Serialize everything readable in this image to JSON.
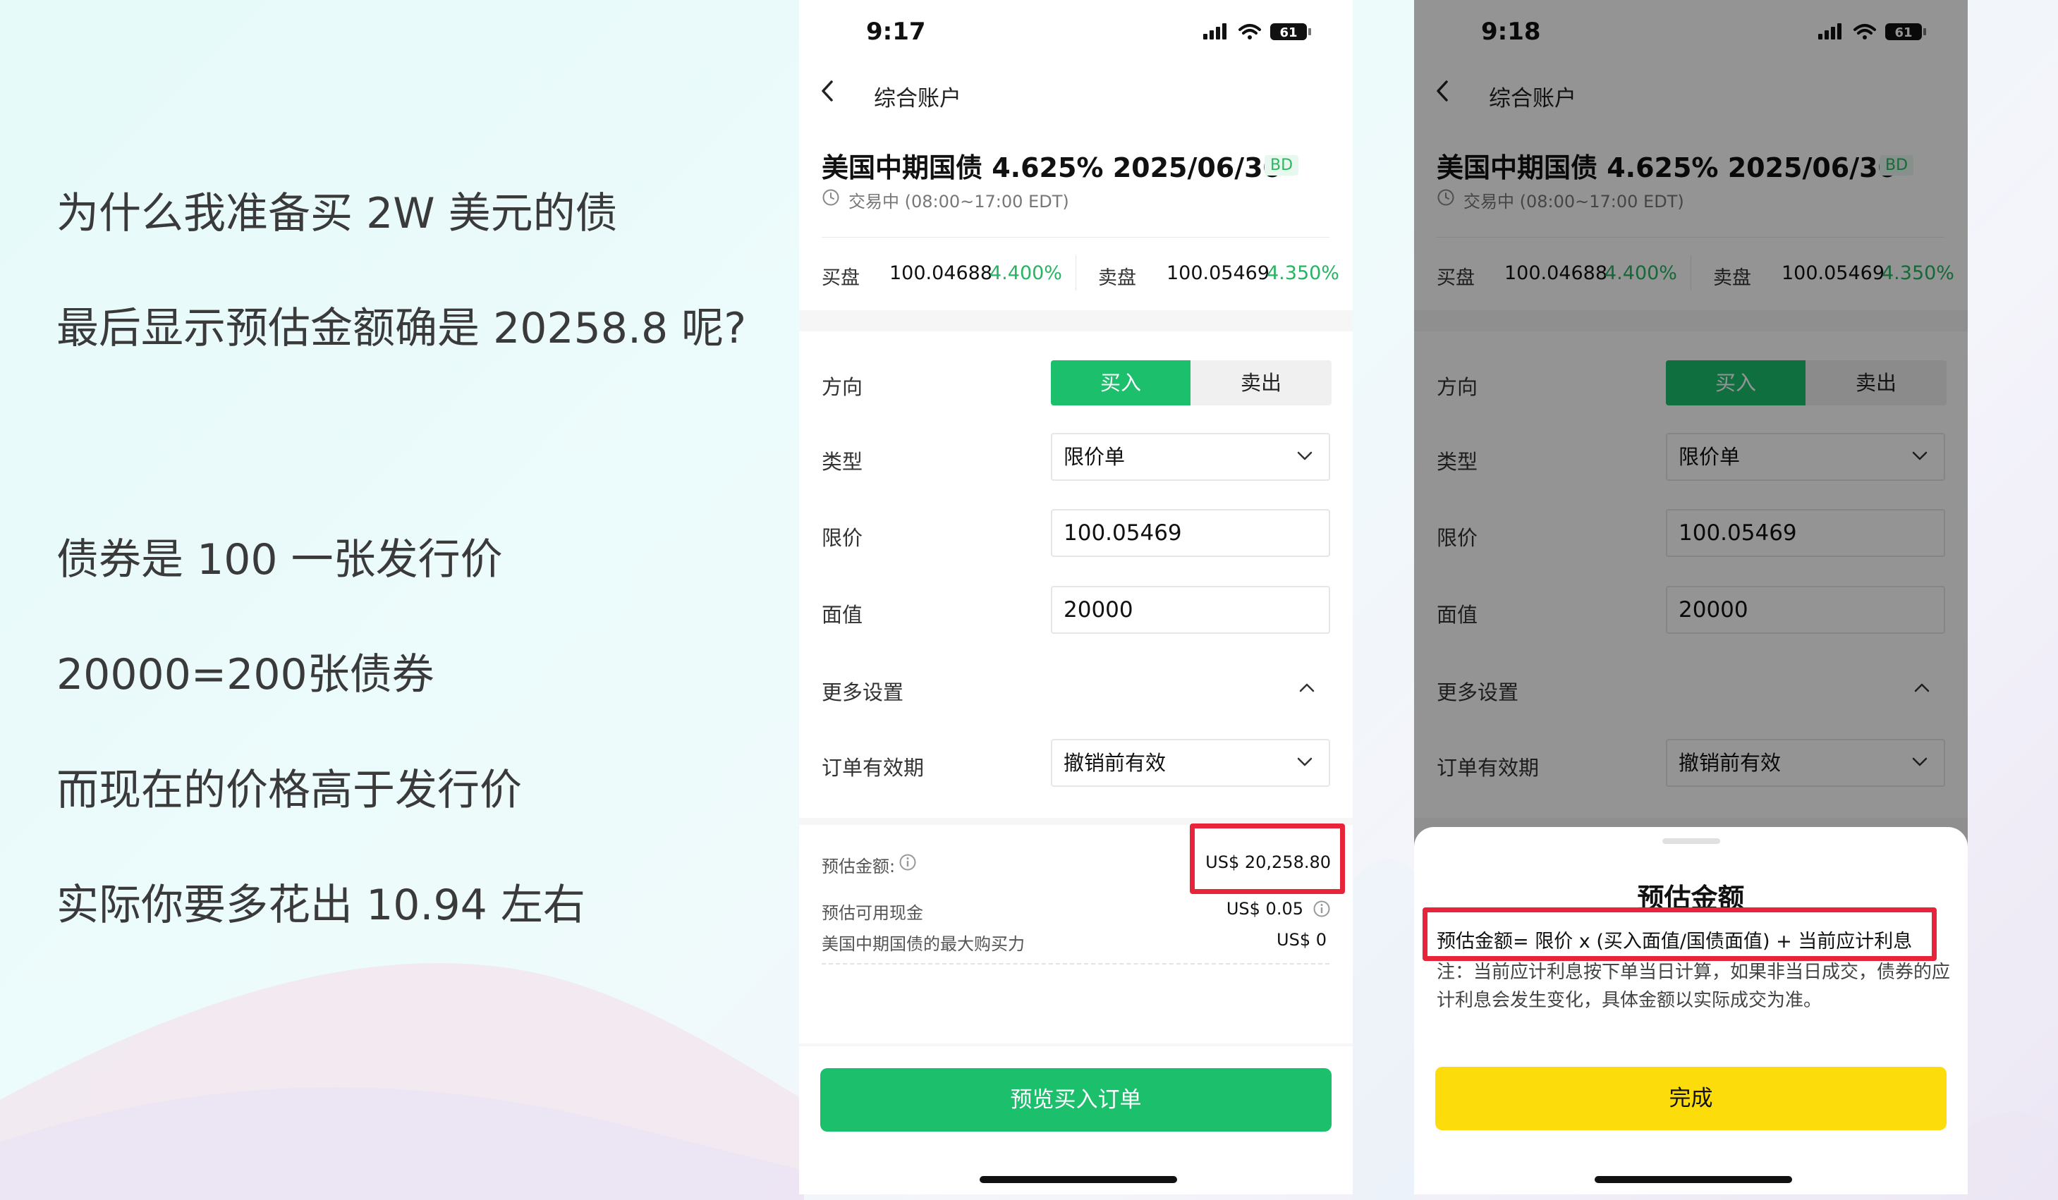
{
  "annotation": {
    "lines": [
      "为什么我准备买 2W 美元的债",
      "最后显示预估金额确是 20258.8 呢?",
      "债券是 100 一张发行价",
      "20000=200张债券",
      "而现在的价格高于发行价",
      "实际你要多花出 10.94 左右"
    ]
  },
  "screen1": {
    "time": "9:17",
    "battery": "61",
    "nav_title": "综合账户",
    "bond_name": "美国中期国债 4.625% 2025/06/30",
    "bond_tag": "BD",
    "trading_status": "交易中 (08:00~17:00 EDT)",
    "bid_label": "买盘",
    "bid_price": "100.04688",
    "bid_yield": "4.400%",
    "ask_label": "卖盘",
    "ask_price": "100.05469",
    "ask_yield": "4.350%",
    "direction_label": "方向",
    "buy_label": "买入",
    "sell_label": "卖出",
    "type_label": "类型",
    "type_value": "限价单",
    "limit_label": "限价",
    "limit_value": "100.05469",
    "face_label": "面值",
    "face_value": "20000",
    "more_settings": "更多设置",
    "validity_label": "订单有效期",
    "validity_value": "撤销前有效",
    "estimate_label": "预估金额:",
    "estimate_value": "US$ 20,258.80",
    "cash_label": "预估可用现金",
    "cash_value": "US$ 0.05",
    "max_power_label": "美国中期国债的最大购买力",
    "max_power_value": "US$ 0",
    "preview_button": "预览买入订单"
  },
  "screen2": {
    "time": "9:18",
    "battery": "61",
    "nav_title": "综合账户",
    "bond_name": "美国中期国债 4.625% 2025/06/30",
    "bond_tag": "BD",
    "trading_status": "交易中 (08:00~17:00 EDT)",
    "bid_label": "买盘",
    "bid_price": "100.04688",
    "bid_yield": "4.400%",
    "ask_label": "卖盘",
    "ask_price": "100.05469",
    "ask_yield": "4.350%",
    "direction_label": "方向",
    "buy_label": "买入",
    "sell_label": "卖出",
    "type_label": "类型",
    "type_value": "限价单",
    "limit_label": "限价",
    "limit_value": "100.05469",
    "face_label": "面值",
    "face_value": "20000",
    "more_settings": "更多设置",
    "validity_label": "订单有效期",
    "validity_value": "撤销前有效",
    "sheet_title": "预估金额",
    "sheet_formula": "预估金额= 限价 x (买入面值/国债面值) + 当前应计利息",
    "sheet_note": "注：当前应计利息按下单当日计算，如果非当日成交，债券的应计利息会发生变化，具体金额以实际成交为准。",
    "done_button": "完成"
  },
  "colors": {
    "brand_green": "#1cbf6c",
    "yield_green": "#27b463",
    "highlight_red": "#e8243a",
    "done_yellow": "#fddc0b"
  }
}
